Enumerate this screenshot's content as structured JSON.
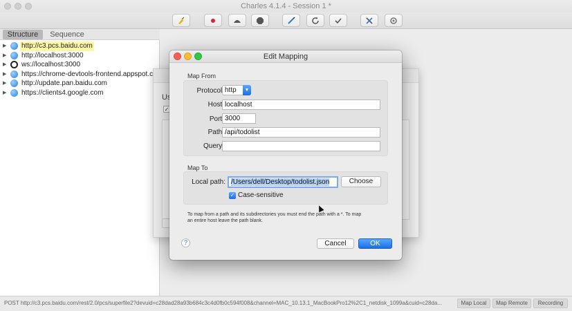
{
  "window": {
    "title": "Charles 4.1.4 - Session 1 *"
  },
  "toolbar": {
    "icons": [
      "broom-icon",
      "record-icon",
      "throttle-icon",
      "breakpoint-icon",
      "compose-icon",
      "repeat-icon",
      "validate-icon",
      "tools-icon",
      "settings-icon"
    ],
    "colors": {
      "record": "#e0242d",
      "compose": "#2f7ad6"
    }
  },
  "sidebar": {
    "tabs": [
      "Structure",
      "Sequence"
    ],
    "items": [
      {
        "label": "http://c3.pcs.baidu.com",
        "icon": "globe-icon",
        "highlighted": true
      },
      {
        "label": "http://localhost:3000",
        "icon": "globe-icon",
        "highlighted": false
      },
      {
        "label": "ws://localhost:3000",
        "icon": "websocket-icon",
        "highlighted": false
      },
      {
        "label": "https://chrome-devtools-frontend.appspot.com",
        "icon": "globe-icon",
        "highlighted": false
      },
      {
        "label": "http://update.pan.baidu.com",
        "icon": "globe-icon",
        "highlighted": false
      },
      {
        "label": "https://clients4.google.com",
        "icon": "globe-icon",
        "highlighted": false
      }
    ]
  },
  "background_dialog": {
    "label": "Us",
    "check": "✓"
  },
  "dialog": {
    "title": "Edit Mapping",
    "map_from": {
      "heading": "Map From",
      "protocol_label": "Protocol:",
      "protocol_value": "http",
      "host_label": "Host:",
      "host_value": "localhost",
      "port_label": "Port:",
      "port_value": "3000",
      "path_label": "Path:",
      "path_value": "/api/todolist",
      "query_label": "Query:",
      "query_value": ""
    },
    "map_to": {
      "heading": "Map To",
      "local_path_label": "Local path:",
      "local_path_value": "/Users/dell/Desktop/todolist.json",
      "choose_label": "Choose",
      "case_sensitive_label": "Case-sensitive",
      "case_sensitive_checked": true
    },
    "help_line1": "To map from a path and its subdirectories you must end the path with a *. To map",
    "help_line2": "an entire host leave the path blank.",
    "help_button": "?",
    "cancel_label": "Cancel",
    "ok_label": "OK"
  },
  "statusbar": {
    "text": "POST http://c3.pcs.baidu.com/rest/2.0/pcs/superfile2?devuid=c28dad28a93b684c3c4d0fb0c594f008&channel=MAC_10.13.1_MacBookPro12%2C1_netdisk_1099a&cuid=c28da...",
    "map_local": "Map Local",
    "map_remote": "Map Remote",
    "recording": "Recording"
  }
}
